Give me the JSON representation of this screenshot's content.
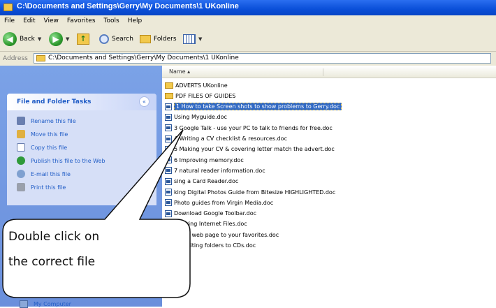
{
  "window": {
    "title": "C:\\Documents and Settings\\Gerry\\My Documents\\1 UKonline"
  },
  "menu": [
    "File",
    "Edit",
    "View",
    "Favorites",
    "Tools",
    "Help"
  ],
  "toolbar": {
    "back_label": "Back",
    "search_label": "Search",
    "folders_label": "Folders"
  },
  "address": {
    "label": "Address",
    "path": "C:\\Documents and Settings\\Gerry\\My Documents\\1 UKonline"
  },
  "tasks": {
    "title": "File and Folder Tasks",
    "items": [
      {
        "label": "Rename this file",
        "icon": "rename-icon"
      },
      {
        "label": "Move this file",
        "icon": "move-icon"
      },
      {
        "label": "Copy this file",
        "icon": "copy-icon"
      },
      {
        "label": "Publish this file to the Web",
        "icon": "globe-icon"
      },
      {
        "label": "E-mail this file",
        "icon": "email-icon"
      },
      {
        "label": "Print this file",
        "icon": "print-icon"
      }
    ]
  },
  "other_places": {
    "my_computer": "My Computer"
  },
  "files": {
    "column_name": "Name",
    "items": [
      {
        "name": "ADVERTS UKonline",
        "type": "folder"
      },
      {
        "name": "PDF FILES OF GUIDES",
        "type": "folder"
      },
      {
        "name": "1 How to take Screen shots to show problems to Gerry.doc",
        "type": "doc",
        "selected": true
      },
      {
        "name": "Using Myguide.doc",
        "type": "doc"
      },
      {
        "name": "3 Google Talk - use your PC to talk to friends for free.doc",
        "type": "doc"
      },
      {
        "name": "4 Writing a CV checklist & resources.doc",
        "type": "doc"
      },
      {
        "name": "5 Making your CV & covering letter match the advert.doc",
        "type": "doc"
      },
      {
        "name": "6 Improving memory.doc",
        "type": "doc"
      },
      {
        "name": "7 natural reader information.doc",
        "type": "doc"
      },
      {
        "name": "sing a Card Reader.doc",
        "type": "doc"
      },
      {
        "name": "king Digital Photos Guide from Bitesize HIGHLIGHTED.doc",
        "type": "doc"
      },
      {
        "name": "Photo guides from Virgin Media.doc",
        "type": "doc"
      },
      {
        "name": "Download Google Toolbar.doc",
        "type": "doc"
      },
      {
        "name": "Clearing Internet Files.doc",
        "type": "doc"
      },
      {
        "name": "Add a web page to your favorites.doc",
        "type": "doc"
      },
      {
        "name": "14 Writing folders to CDs.doc",
        "type": "doc"
      }
    ]
  },
  "callout": {
    "line1": "Double click on",
    "line2": "the correct file"
  },
  "colors": {
    "title_bar": "#0a4fd8",
    "selection": "#316ac5",
    "task_link": "#215dc6"
  }
}
